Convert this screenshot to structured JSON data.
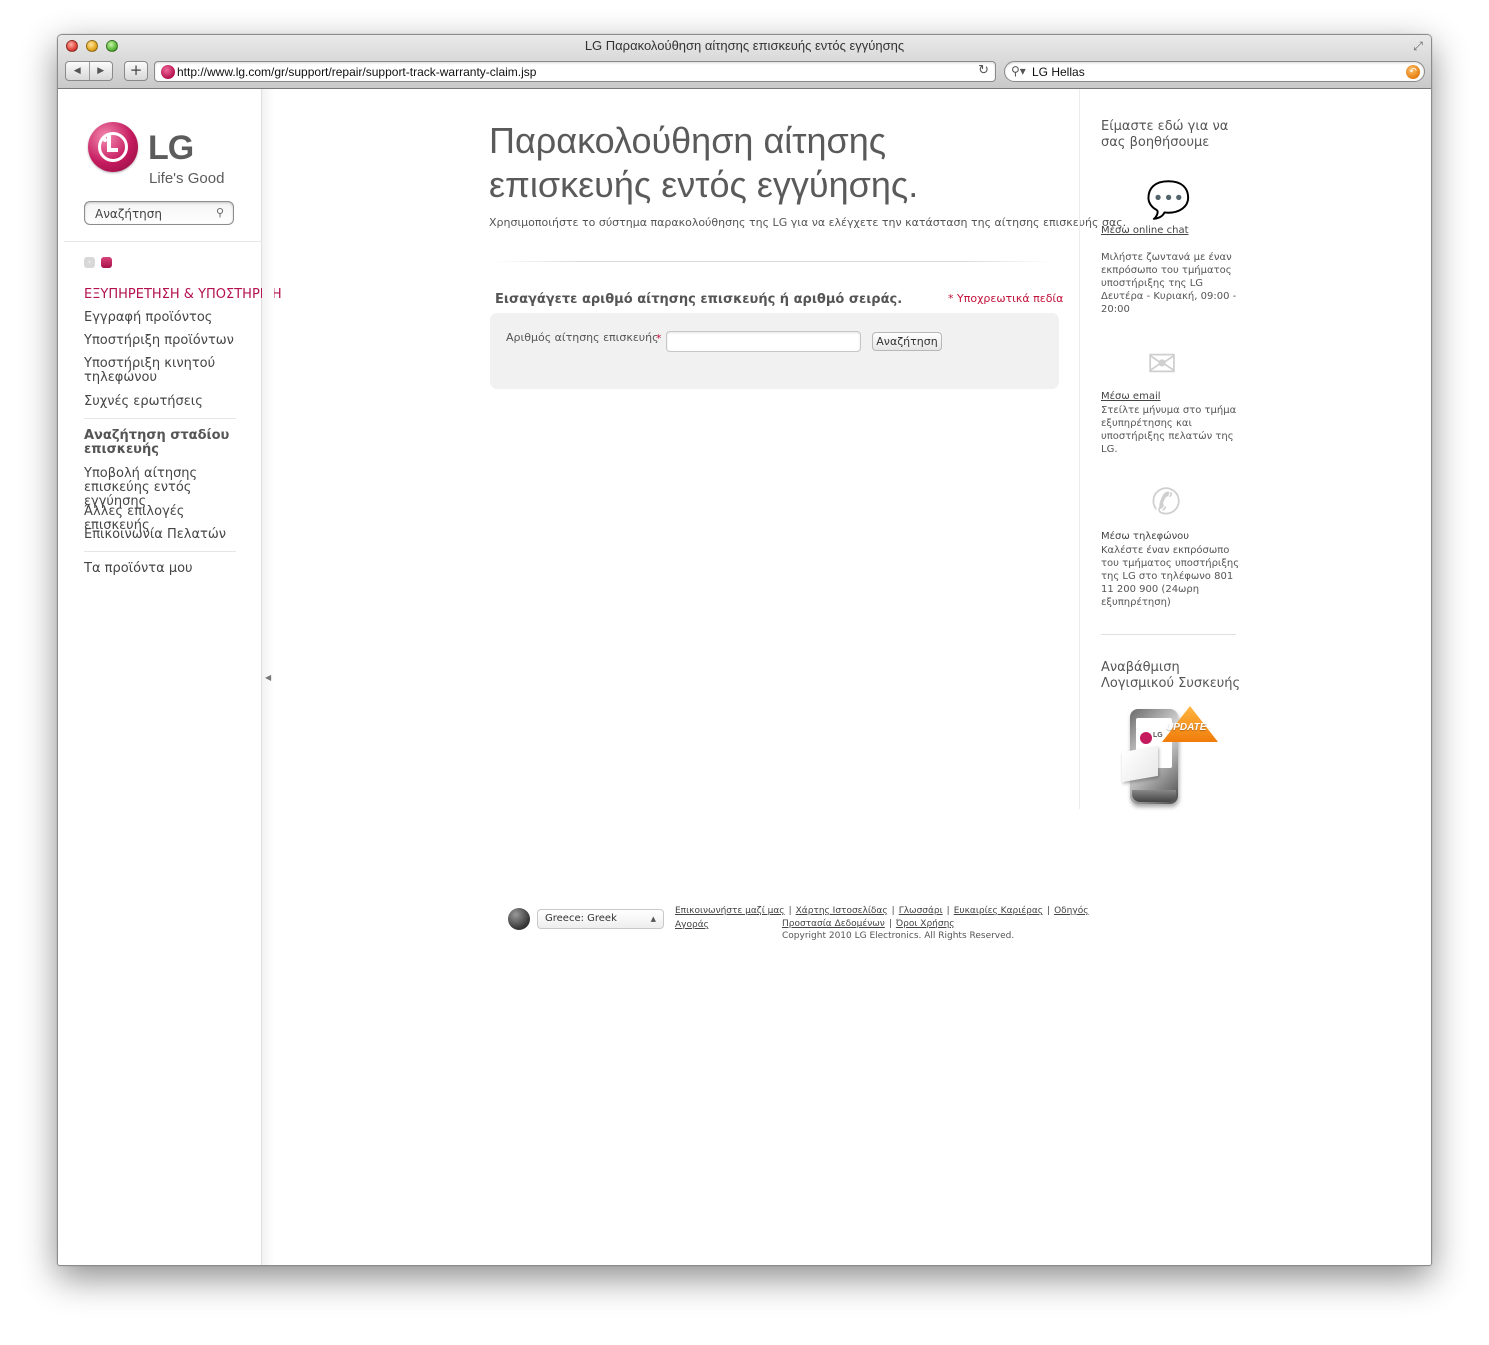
{
  "browser": {
    "window_title": "LG Παρακολούθηση αίτησης επισκευής εντός εγγύησης",
    "url": "http://www.lg.com/gr/support/repair/support-track-warranty-claim.jsp",
    "search_value": "LG Hellas"
  },
  "logo": {
    "brand": "LG",
    "tagline": "Life's Good"
  },
  "sidebar": {
    "search_value": "Αναζήτηση",
    "heading": "ΕΞΥΠΗΡΕΤΗΣΗ & ΥΠΟΣΤΗΡΙΞΗ",
    "items": [
      {
        "label": "Εγγραφή προϊόντος"
      },
      {
        "label": "Υποστήριξη προϊόντων"
      },
      {
        "label": "Υποστήριξη κινητού τηλεφώνου"
      },
      {
        "label": "Συχνές ερωτήσεις"
      },
      {
        "label": "Αναζήτηση σταδίου επισκευής"
      },
      {
        "label": "Υποβολή αίτησης επισκεύης εντός εγγύησης"
      },
      {
        "label": "Άλλες επιλογές επισκευής"
      },
      {
        "label": "Επικοινωνία Πελατών"
      },
      {
        "label": "Τα προϊόντα μου"
      }
    ]
  },
  "main": {
    "title": "Παρακολούθηση αίτησης επισκευής εντός εγγύησης.",
    "description": "Χρησιμοποιήστε το σύστημα παρακολούθησης της LG για να ελέγχετε την κατάσταση της αίτησης επισκευής σας.",
    "form_heading": "Εισαγάγετε αριθμό αίτησης επισκευής ή αριθμό σειράς.",
    "required_note": "* Υποχρεωτικά πεδία",
    "field_label": "Αριθμός αίτησης επισκευής",
    "field_required_mark": "*",
    "field_value": "",
    "search_button": "Αναζήτηση"
  },
  "rail": {
    "title": "Είμαστε εδώ για να σας βοηθήσουμε",
    "chat_link": "Μέσω online chat",
    "chat_text": "Μιλήστε ζωντανά με έναν εκπρόσωπο του τμήματος υποστήριξης της LG Δευτέρα - Κυριακή, 09:00 - 20:00",
    "email_link": "Μέσω email",
    "email_text": "Στείλτε μήνυμα στο τμήμα εξυπηρέτησης και υποστήριξης πελατών της LG.",
    "phone_label": "Μέσω τηλεφώνου",
    "phone_text": "Καλέστε έναν εκπρόσωπο του τμήματος υποστήριξης της LG στο τηλέφωνο 801 11 200 900 (24ωρη εξυπηρέτηση)",
    "update_title": "Αναβάθμιση Λογισμικού Συσκευής",
    "update_badge": "UPDATE",
    "update_phone_logo": "LG"
  },
  "footer": {
    "country": "Greece: Greek",
    "links_row1": [
      "Επικοινωνήστε μαζί μας",
      "Χάρτης Ιστοσελίδας",
      "Γλωσσάρι",
      "Ευκαιρίες Καριέρας",
      "Οδηγός Αγοράς"
    ],
    "links_row2": [
      "Προστασία Δεδομένων",
      "Όροι Χρήσης"
    ],
    "separator": "|",
    "copyright": "Copyright 2010 LG Electronics. All Rights Reserved."
  }
}
